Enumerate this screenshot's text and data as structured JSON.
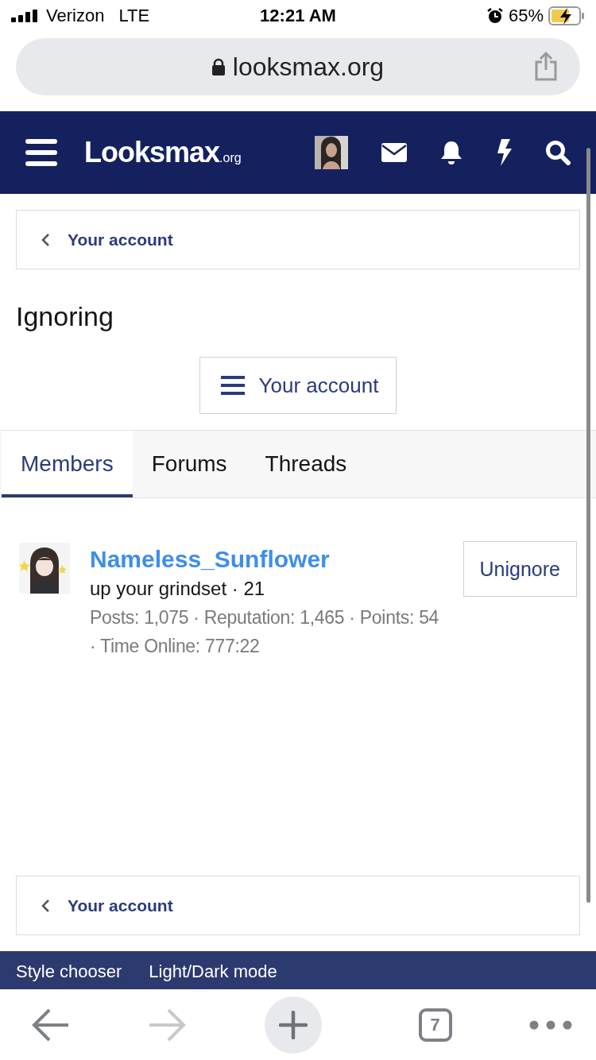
{
  "status_bar": {
    "carrier": "Verizon",
    "network": "LTE",
    "time": "12:21 AM",
    "battery": "65%"
  },
  "browser": {
    "url": "looksmax.org",
    "tab_count": "7",
    "back_disabled": false,
    "forward_disabled": true
  },
  "nav": {
    "logo": "Looksmax",
    "logo_suffix": ".org"
  },
  "breadcrumb_top": {
    "label": "Your account"
  },
  "title": "Ignoring",
  "account_button": {
    "label": "Your account"
  },
  "tabs": [
    {
      "label": "Members",
      "selected": true
    },
    {
      "label": "Forums",
      "selected": false
    },
    {
      "label": "Threads",
      "selected": false
    }
  ],
  "members": [
    {
      "name": "Nameless_Sunflower",
      "title": "up your grindset · 21",
      "stats": "Posts: 1,075 · Reputation: 1,465 · Points: 54 · Time Online: 777:22",
      "action": "Unignore"
    }
  ],
  "breadcrumb_bottom": {
    "label": "Your account"
  },
  "footer_links": [
    "Style chooser",
    "Light/Dark mode"
  ]
}
